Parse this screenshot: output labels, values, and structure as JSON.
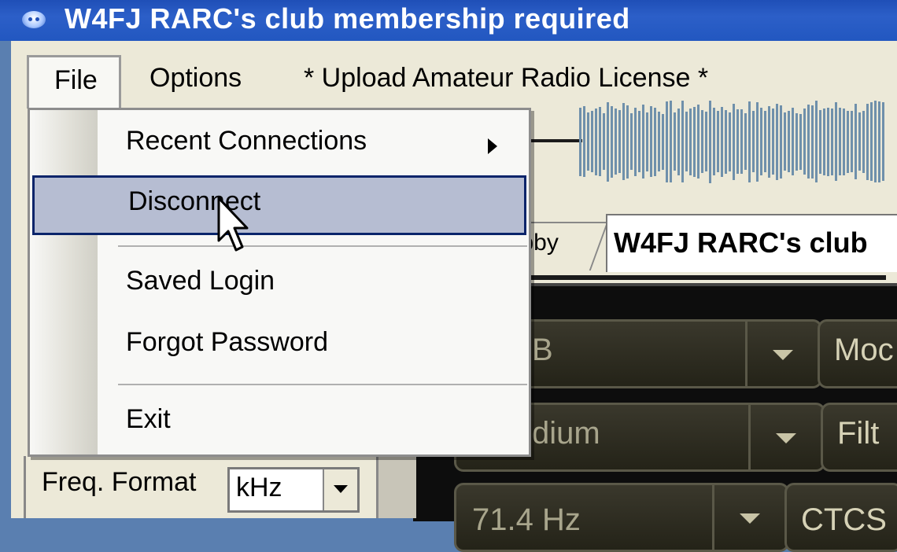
{
  "window": {
    "title": "W4FJ RARC's club membership required"
  },
  "menubar": {
    "file": "File",
    "options": "Options",
    "upload": "* Upload Amateur Radio License *"
  },
  "file_menu": {
    "items": [
      {
        "label": "Recent Connections",
        "has_submenu": true
      },
      {
        "label": "Disconnect",
        "highlighted": true
      },
      {
        "label": "Saved Login"
      },
      {
        "label": "Forgot Password"
      },
      {
        "label": "Exit"
      }
    ]
  },
  "tabs": {
    "lobby": "bby",
    "club": "W4FJ RARC's club"
  },
  "settings": {
    "freq_format_label": "Freq. Format",
    "freq_format_value": "kHz"
  },
  "radio": {
    "mode_value": "B",
    "mode_label": "Moc",
    "filter_value": "dium",
    "filter_label": "Filt",
    "ctcss_value": "71.4 Hz",
    "ctcss_label": "CTCS"
  },
  "colors": {
    "titlebar": "#2257c0",
    "menu_highlight": "#b6bdd2",
    "menu_highlight_border": "#0a246a",
    "radio_panel": "#0d0d0d"
  }
}
